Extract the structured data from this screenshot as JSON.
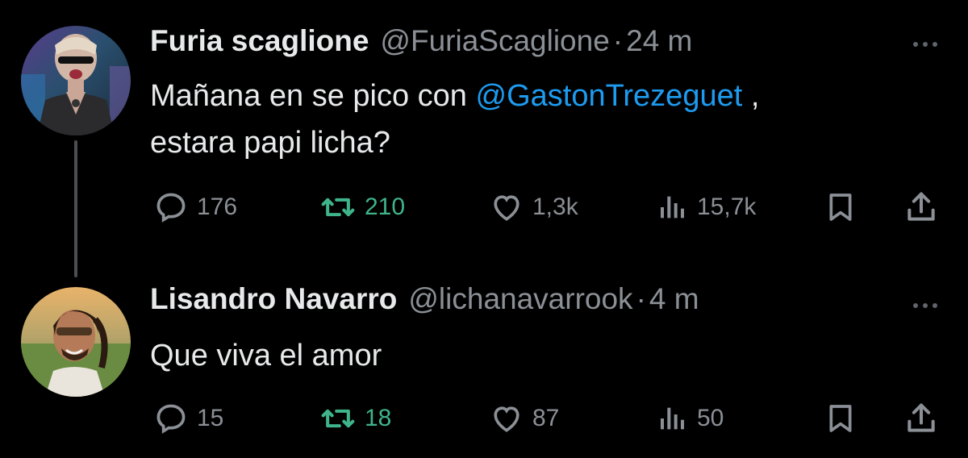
{
  "tweets": [
    {
      "display_name": "Furia scaglione",
      "handle": "@FuriaScaglione",
      "separator": "·",
      "time": "24 m",
      "body_text_1": "Mañana en se pico con ",
      "mention": "@GastonTrezeguet",
      "body_text_2": " ,",
      "body_text_3": "estara papi licha?",
      "replies": "176",
      "retweets": "210",
      "likes": "1,3k",
      "views": "15,7k"
    },
    {
      "display_name": "Lisandro Navarro",
      "handle": "@lichanavarrook",
      "separator": "·",
      "time": "4 m",
      "body_text": "Que viva el amor",
      "replies": "15",
      "retweets": "18",
      "likes": "87",
      "views": "50"
    }
  ],
  "icons": {
    "reply": "reply-icon",
    "retweet": "retweet-icon",
    "like": "heart-icon",
    "views": "views-icon",
    "bookmark": "bookmark-icon",
    "share": "share-icon",
    "more": "more-icon"
  },
  "colors": {
    "background": "#000000",
    "text": "#e7e9ea",
    "secondary_text": "#8b9096",
    "mention": "#1d9bf0",
    "retweet_active": "#3fb48a",
    "thread_line": "#4a4f54"
  }
}
